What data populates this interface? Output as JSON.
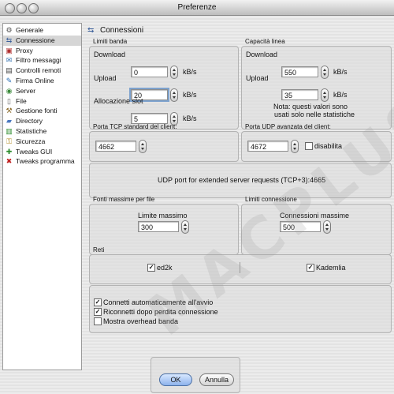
{
  "window": {
    "title": "Preferenze"
  },
  "sidebar": {
    "items": [
      {
        "label": "Generale",
        "icon": "gear-icon",
        "selected": false
      },
      {
        "label": "Connessione",
        "icon": "connection-icon",
        "selected": true
      },
      {
        "label": "Proxy",
        "icon": "proxy-icon",
        "selected": false
      },
      {
        "label": "Filtro messaggi",
        "icon": "message-filter-icon",
        "selected": false
      },
      {
        "label": "Controlli remoti",
        "icon": "remote-control-icon",
        "selected": false
      },
      {
        "label": "Firma Online",
        "icon": "online-signature-icon",
        "selected": false
      },
      {
        "label": "Server",
        "icon": "server-icon",
        "selected": false
      },
      {
        "label": "File",
        "icon": "file-icon",
        "selected": false
      },
      {
        "label": "Gestione fonti",
        "icon": "sources-icon",
        "selected": false
      },
      {
        "label": "Directory",
        "icon": "directory-icon",
        "selected": false
      },
      {
        "label": "Statistiche",
        "icon": "statistics-icon",
        "selected": false
      },
      {
        "label": "Sicurezza",
        "icon": "security-icon",
        "selected": false
      },
      {
        "label": "Tweaks GUI",
        "icon": "tweaks-gui-icon",
        "selected": false
      },
      {
        "label": "Tweaks programma",
        "icon": "tweaks-program-icon",
        "selected": false
      }
    ]
  },
  "header": {
    "title": "Connessioni",
    "icon": "connection-icon"
  },
  "bandwidth": {
    "title": "Limiti banda",
    "download_label": "Download",
    "download_value": "0",
    "download_unit": "kB/s",
    "upload_label": "Upload",
    "upload_value": "20",
    "upload_unit": "kB/s",
    "slot_label": "Allocazione slot",
    "slot_value": "5",
    "slot_unit": "kB/s"
  },
  "capacity": {
    "title": "Capacità linea",
    "download_label": "Download",
    "download_value": "550",
    "download_unit": "kB/s",
    "upload_label": "Upload",
    "upload_value": "35",
    "upload_unit": "kB/s",
    "note_line1": "Nota: questi valori sono",
    "note_line2": "usati solo nelle statistiche"
  },
  "tcp": {
    "title": "Porta TCP standard del client:",
    "value": "4662"
  },
  "udp": {
    "title": "Porta UDP avanzata del client:",
    "value": "4672",
    "disable_label": "disabilita",
    "disable_checked": false
  },
  "extended": {
    "text": "UDP port for extended server requests (TCP+3):4665"
  },
  "max_sources": {
    "title": "Fonti massime per file",
    "label": "Limite massimo",
    "value": "300"
  },
  "conn_limits": {
    "title": "Limiti connessione",
    "label": "Connessioni massime",
    "value": "500"
  },
  "networks": {
    "title": "Reti",
    "ed2k_label": "ed2k",
    "ed2k_checked": true,
    "kad_label": "Kademlia",
    "kad_checked": true
  },
  "options": [
    {
      "label": "Connetti automaticamente all'avvio",
      "checked": true
    },
    {
      "label": "Riconnetti dopo perdita connessione",
      "checked": true
    },
    {
      "label": "Mostra overhead banda",
      "checked": false
    }
  ],
  "buttons": {
    "ok": "OK",
    "cancel": "Annulla"
  },
  "watermark": "MACPLUS",
  "colors": {
    "selection": "#d6d6d6",
    "default_button": "#8db2ec",
    "focus_ring": "#7da2ce"
  }
}
